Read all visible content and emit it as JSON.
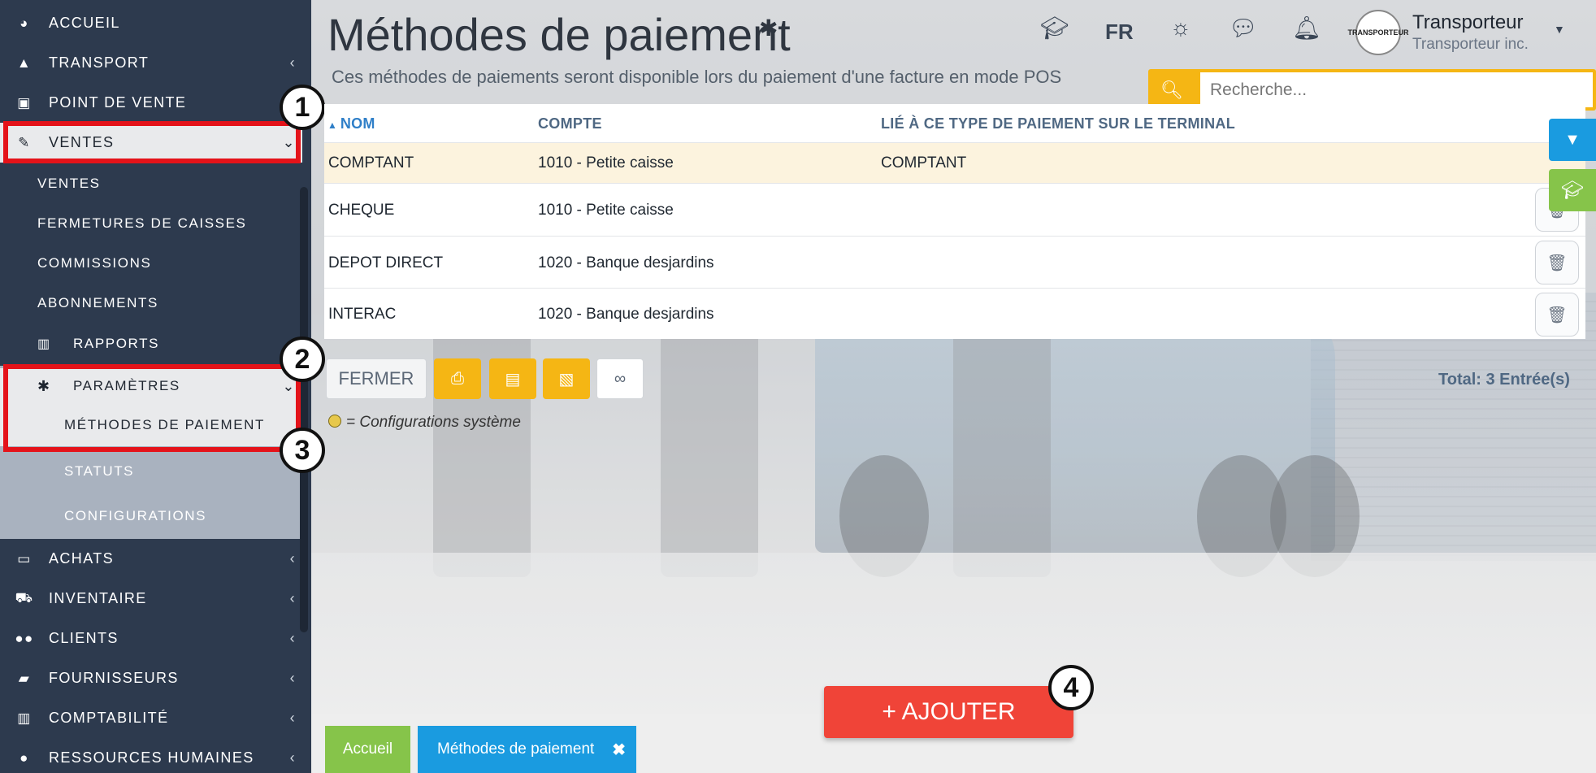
{
  "sidebar": {
    "items": [
      {
        "label": "ACCUEIL",
        "icon": "dashboard-icon"
      },
      {
        "label": "TRANSPORT",
        "icon": "road-icon"
      },
      {
        "label": "POINT DE VENTE",
        "icon": "cash-icon"
      },
      {
        "label": "VENTES",
        "icon": "edit-icon"
      },
      {
        "label": "ACHATS",
        "icon": "credit-card-icon"
      },
      {
        "label": "INVENTAIRE",
        "icon": "cart-icon"
      },
      {
        "label": "CLIENTS",
        "icon": "users-icon"
      },
      {
        "label": "FOURNISSEURS",
        "icon": "truck-icon"
      },
      {
        "label": "COMPTABILITÉ",
        "icon": "bar-chart-icon"
      },
      {
        "label": "RESSOURCES HUMAINES",
        "icon": "person-icon"
      }
    ],
    "ventes_sub": {
      "ventes": "VENTES",
      "fermetures": "FERMETURES DE CAISSES",
      "commissions": "COMMISSIONS",
      "abonnements": "ABONNEMENTS",
      "rapports": "RAPPORTS",
      "parametres": "PARAMÈTRES",
      "methodes": "MÉTHODES DE PAIEMENT",
      "statuts": "STATUTS",
      "configurations": "CONFIGURATIONS"
    }
  },
  "annotations": {
    "one": "1",
    "two": "2",
    "three": "3",
    "four": "4"
  },
  "header": {
    "title": "Méthodes de paiement",
    "subtitle": "Ces méthodes de paiements seront disponible lors du paiement d'une facture en mode POS",
    "lang": "FR",
    "user_name": "Transporteur",
    "user_company": "Transporteur inc.",
    "avatar_text": "TRANSPORTEUR"
  },
  "search": {
    "placeholder": "Recherche..."
  },
  "table": {
    "headers": {
      "nom": "NOM",
      "compte": "COMPTE",
      "lie": "LIÉ À CE TYPE DE PAIEMENT SUR LE TERMINAL"
    },
    "rows": [
      {
        "nom": "COMPTANT",
        "compte": "1010 - Petite caisse",
        "lie": "COMPTANT"
      },
      {
        "nom": "CHEQUE",
        "compte": "1010 - Petite caisse",
        "lie": ""
      },
      {
        "nom": "DEPOT DIRECT",
        "compte": "1020 - Banque desjardins",
        "lie": ""
      },
      {
        "nom": "INTERAC",
        "compte": "1020 - Banque desjardins",
        "lie": ""
      }
    ]
  },
  "toolbar": {
    "fermer": "FERMER",
    "total": "Total: 3 Entrée(s)"
  },
  "legend": "= Configurations système",
  "bottom": {
    "accueil": "Accueil",
    "active_tab": "Méthodes de paiement",
    "ajouter": "+ AJOUTER"
  },
  "colors": {
    "sidebar": "#2d3a4e",
    "accent_yellow": "#f5b614",
    "accent_blue": "#1a9be0",
    "accent_green": "#86c44a",
    "accent_red": "#f04438",
    "highlight": "#e4131a"
  }
}
